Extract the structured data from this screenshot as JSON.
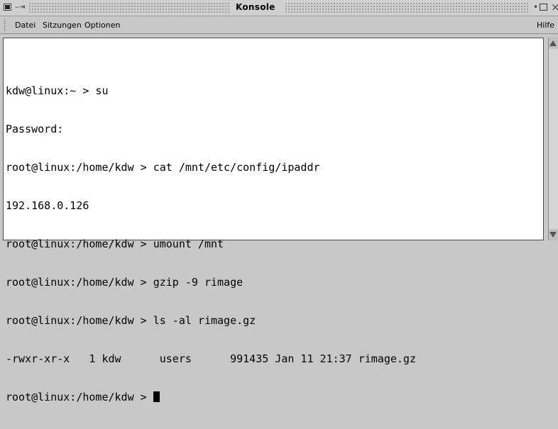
{
  "window": {
    "title": "Konsole",
    "pin_icon": "pin-icon",
    "min_icon": "minimize-icon",
    "max_icon": "maximize-icon",
    "close_icon": "close-icon",
    "pin_glyph": "–⇥",
    "min_glyph": "•",
    "close_glyph": "×"
  },
  "menu": {
    "items": [
      "Datei",
      "Sitzungen",
      "Optionen"
    ],
    "help": "Hilfe"
  },
  "terminal": {
    "lines": [
      "kdw@linux:~ > su",
      "Password:",
      "root@linux:/home/kdw > cat /mnt/etc/config/ipaddr",
      "192.168.0.126",
      "root@linux:/home/kdw > umount /mnt",
      "root@linux:/home/kdw > gzip -9 rimage",
      "root@linux:/home/kdw > ls -al rimage.gz",
      "-rwxr-xr-x   1 kdw      users      991435 Jan 11 21:37 rimage.gz"
    ],
    "prompt": "root@linux:/home/kdw > "
  }
}
